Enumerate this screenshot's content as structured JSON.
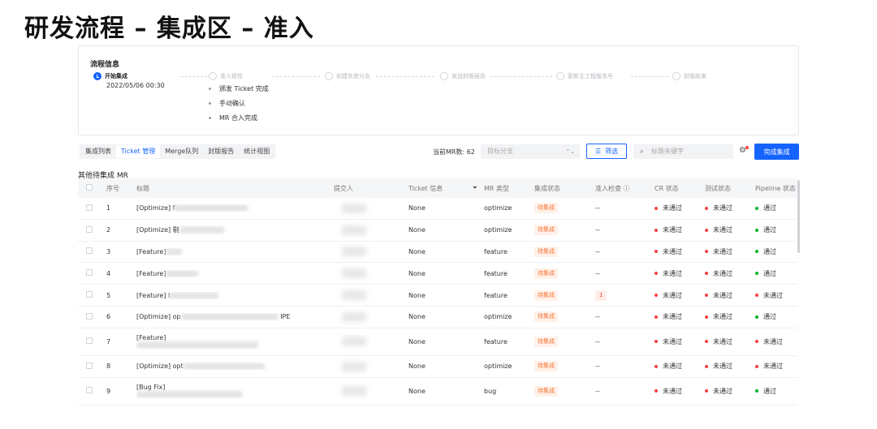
{
  "slide_title": "研发流程 – 集成区 – 准入",
  "flow": {
    "title": "流程信息",
    "steps": [
      {
        "label": "开始集成",
        "active": true
      },
      {
        "label": "准入管控",
        "active": false
      },
      {
        "label": "创建灰度分支",
        "active": false
      },
      {
        "label": "发送封版报告",
        "active": false
      },
      {
        "label": "更新主工程版本号",
        "active": false
      },
      {
        "label": "封版结束",
        "active": false
      }
    ],
    "time": "2022/05/06 00:30",
    "sub_items": [
      "颁发 Ticket 完成",
      "手动确认",
      "MR 合入完成"
    ]
  },
  "toolbar": {
    "tabs": [
      "集成列表",
      "Ticket 管理",
      "Merge队列",
      "封版报告",
      "统计视图"
    ],
    "active_tab": 1,
    "mr_count": "当前MR数: 62",
    "branch_placeholder": "目标分支",
    "filter_label": "筛选",
    "search_placeholder": "标题关键字",
    "complete_label": "完成集成"
  },
  "section_title": "其他待集成 MR",
  "table": {
    "headers": {
      "index": "序号",
      "title": "标题",
      "submitter": "提交人",
      "ticket": "Ticket 信息",
      "type": "MR 类型",
      "merge_status": "集成状态",
      "check": "准入检查 ⓘ",
      "cr": "CR 状态",
      "test": "测试状态",
      "pipeline": "Pipeline 状态"
    },
    "rows": [
      {
        "index": "1",
        "title": "[Optimize] f",
        "title_tail": "",
        "ticket": "None",
        "type": "optimize",
        "merge": "待集成",
        "check": "--",
        "cr": "未通过",
        "test": "未通过",
        "pipeline": "通过",
        "pipeline_ok": true
      },
      {
        "index": "2",
        "title": "[Optimize] 剔",
        "title_tail": "",
        "ticket": "None",
        "type": "optimize",
        "merge": "待集成",
        "check": "--",
        "cr": "未通过",
        "test": "未通过",
        "pipeline": "通过",
        "pipeline_ok": true
      },
      {
        "index": "3",
        "title": "[Feature] ",
        "title_tail": "",
        "ticket": "None",
        "type": "feature",
        "merge": "待集成",
        "check": "--",
        "cr": "未通过",
        "test": "未通过",
        "pipeline": "通过",
        "pipeline_ok": true
      },
      {
        "index": "4",
        "title": "[Feature] ",
        "title_tail": "",
        "ticket": "None",
        "type": "feature",
        "merge": "待集成",
        "check": "--",
        "cr": "未通过",
        "test": "未通过",
        "pipeline": "通过",
        "pipeline_ok": true
      },
      {
        "index": "5",
        "title": "[Feature] I",
        "title_tail": "",
        "ticket": "None",
        "type": "feature",
        "merge": "待集成",
        "check": "1",
        "cr": "未通过",
        "test": "未通过",
        "pipeline": "未通过",
        "pipeline_ok": false
      },
      {
        "index": "6",
        "title": "[Optimize] op",
        "title_tail": "IPE",
        "ticket": "None",
        "type": "optimize",
        "merge": "待集成",
        "check": "--",
        "cr": "未通过",
        "test": "未通过",
        "pipeline": "通过",
        "pipeline_ok": true
      },
      {
        "index": "7",
        "title": "[Feature]",
        "title_tail": "",
        "ticket": "None",
        "type": "feature",
        "merge": "待集成",
        "check": "--",
        "cr": "未通过",
        "test": "未通过",
        "pipeline": "未通过",
        "pipeline_ok": false
      },
      {
        "index": "8",
        "title": "[Optimize] opt",
        "title_tail": "",
        "ticket": "None",
        "type": "optimize",
        "merge": "待集成",
        "check": "--",
        "cr": "未通过",
        "test": "未通过",
        "pipeline": "未通过",
        "pipeline_ok": false
      },
      {
        "index": "9",
        "title": "[Bug Fix]",
        "title_tail": "",
        "ticket": "None",
        "type": "bug",
        "merge": "待集成",
        "check": "--",
        "cr": "未通过",
        "test": "未通过",
        "pipeline": "通过",
        "pipeline_ok": true
      }
    ]
  },
  "colors": {
    "primary": "#1664ff",
    "danger": "#f53f3f",
    "success": "#00b42a",
    "warning": "#f77234"
  }
}
